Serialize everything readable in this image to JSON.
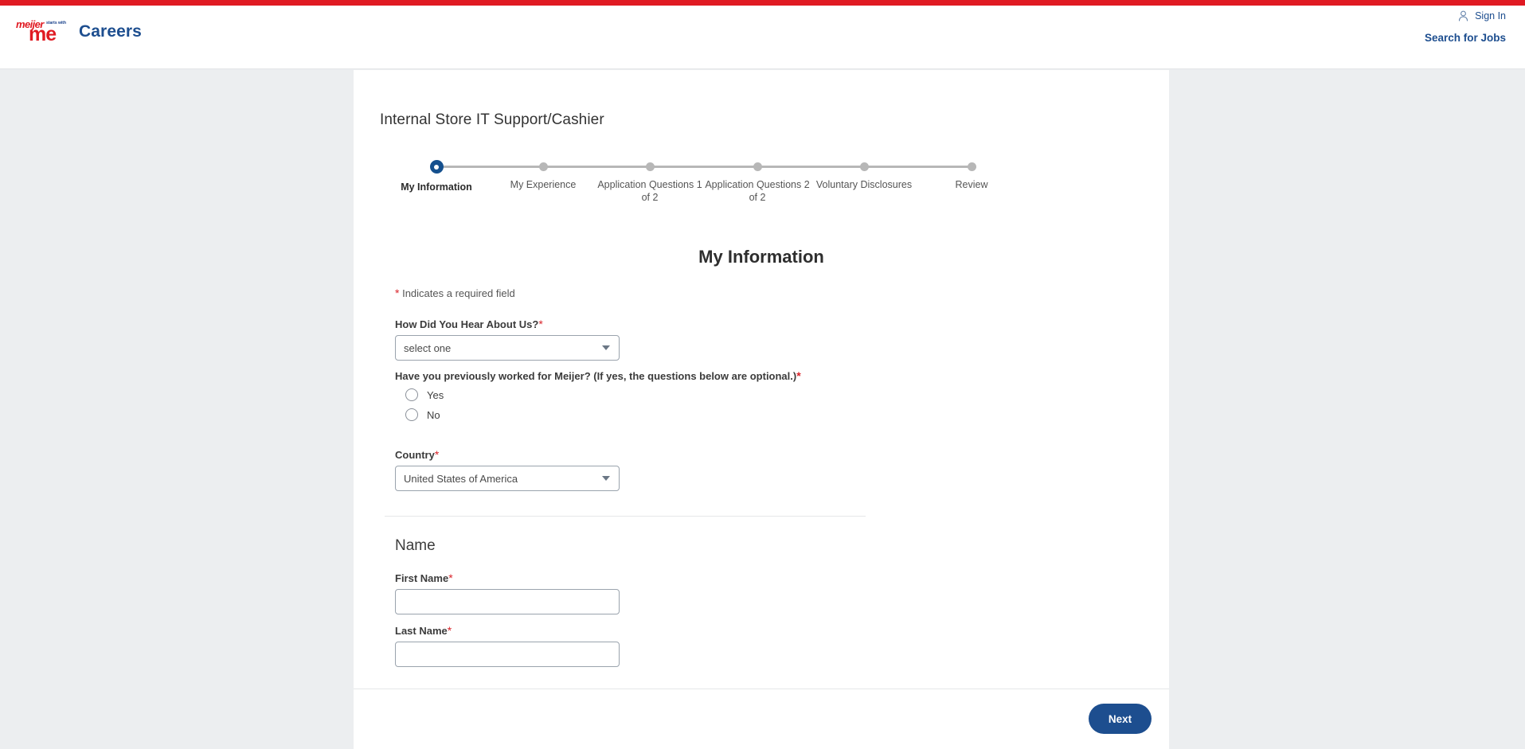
{
  "header": {
    "logo": {
      "brand": "meijer",
      "tagline": "starts with",
      "word": "me"
    },
    "careers_label": "Careers",
    "sign_in_label": "Sign In",
    "search_jobs_label": "Search for Jobs",
    "accent_blue": "#1d4e8f",
    "accent_red": "#e01a22"
  },
  "job": {
    "title": "Internal Store IT Support/Cashier"
  },
  "stepper": {
    "steps": [
      {
        "label": "My Information",
        "state": "active"
      },
      {
        "label": "My Experience",
        "state": "upcoming"
      },
      {
        "label": "Application Questions 1 of 2",
        "state": "upcoming"
      },
      {
        "label": "Application Questions 2 of 2",
        "state": "upcoming"
      },
      {
        "label": "Voluntary Disclosures",
        "state": "upcoming"
      },
      {
        "label": "Review",
        "state": "upcoming"
      }
    ],
    "active_color": "#15508e",
    "inactive_color": "#b7b7b7"
  },
  "form": {
    "heading": "My Information",
    "required_note": "Indicates a required field",
    "required_marker": "*",
    "hear_about_us": {
      "label": "How Did You Hear About Us?",
      "value": "select one",
      "required": true
    },
    "previously_worked": {
      "label": "Have you previously worked for Meijer? (If yes, the questions below are optional.)",
      "required": true,
      "options": [
        {
          "label": "Yes",
          "selected": false
        },
        {
          "label": "No",
          "selected": false
        }
      ]
    },
    "country": {
      "label": "Country",
      "value": "United States of America",
      "required": true
    },
    "name_section": {
      "title": "Name",
      "first_name": {
        "label": "First Name",
        "value": "",
        "required": true
      },
      "last_name": {
        "label": "Last Name",
        "value": "",
        "required": true
      }
    }
  },
  "footer": {
    "next_label": "Next"
  }
}
